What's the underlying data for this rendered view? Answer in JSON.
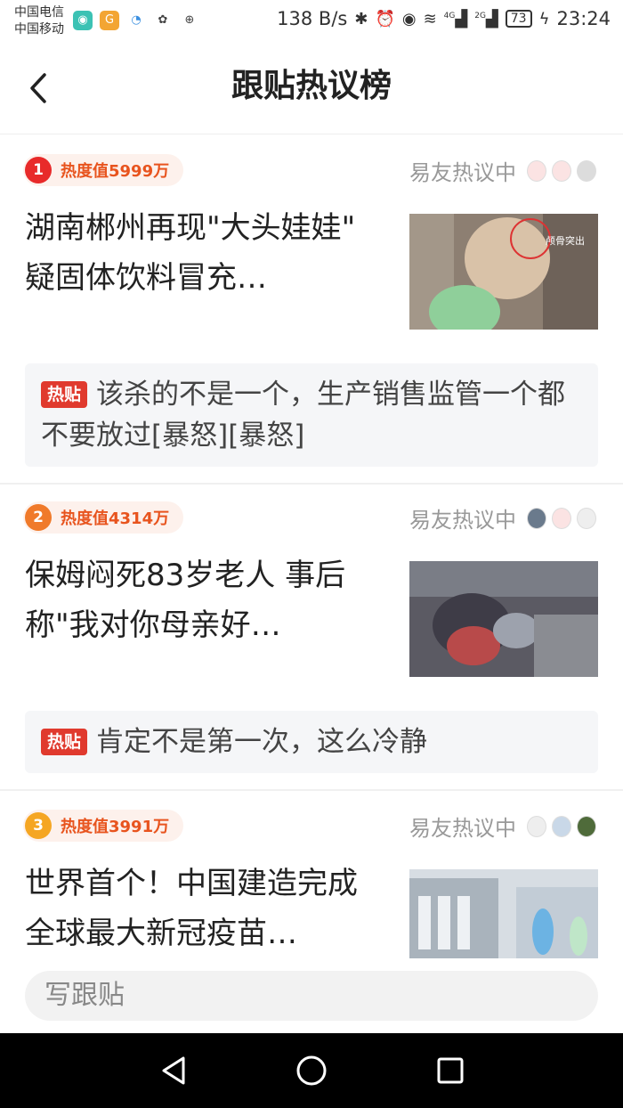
{
  "status_bar": {
    "carrier_1": "中国电信",
    "carrier_2": "中国移动",
    "net_speed": "138 B/s",
    "signal_1": "4G",
    "signal_2": "2G",
    "battery": "73",
    "time": "23:24"
  },
  "header": {
    "title": "跟贴热议榜"
  },
  "items": [
    {
      "rank": "1",
      "rank_color": "#e82a2a",
      "heat": "热度值5999万",
      "discuss_label": "易友热议中",
      "headline": "湖南郴州再现\"大头娃娃\" 疑固体饮料冒充…",
      "thumb_caption": "颅骨突出",
      "hot_tag": "热贴",
      "comment": "该杀的不是一个，生产销售监管一个都不要放过[暴怒][暴怒]"
    },
    {
      "rank": "2",
      "rank_color": "#f07a2a",
      "heat": "热度值4314万",
      "discuss_label": "易友热议中",
      "headline": "保姆闷死83岁老人 事后称\"我对你母亲好…",
      "thumb_caption": "",
      "hot_tag": "热贴",
      "comment": "肯定不是第一次，这么冷静"
    },
    {
      "rank": "3",
      "rank_color": "#f5a623",
      "heat": "热度值3991万",
      "discuss_label": "易友热议中",
      "headline": "世界首个！中国建造完成全球最大新冠疫苗…",
      "thumb_caption": ""
    }
  ],
  "reply": {
    "placeholder": "写跟贴"
  },
  "icons": {
    "back": "chevron-left-icon",
    "nav_back": "triangle-back-icon",
    "nav_home": "circle-home-icon",
    "nav_recent": "square-recent-icon"
  }
}
